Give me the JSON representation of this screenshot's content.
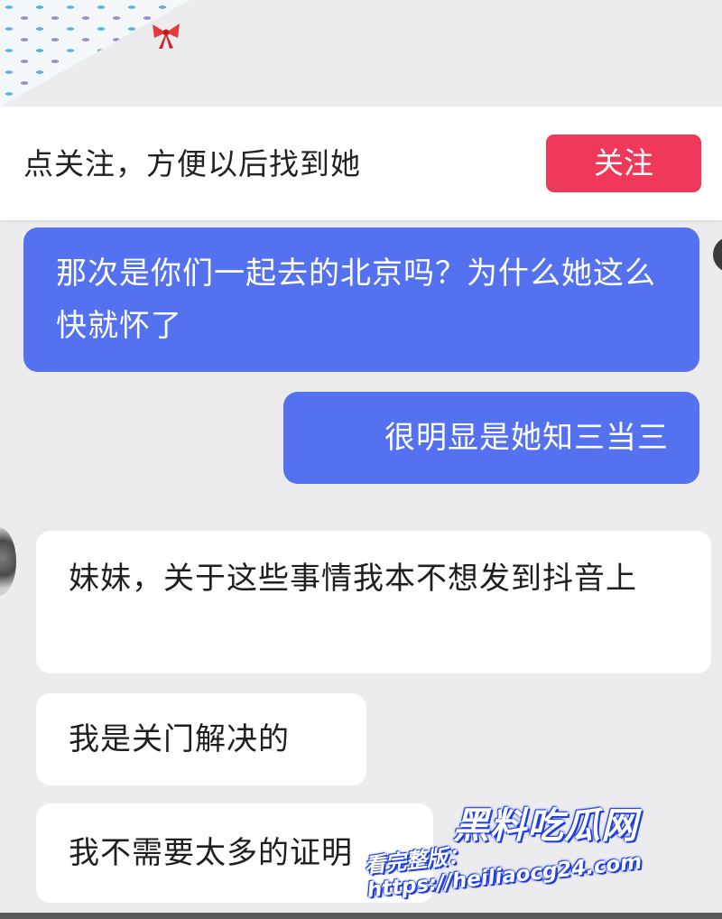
{
  "follow_bar": {
    "prompt": "点关注，方便以后找到她",
    "follow_label": "关注",
    "accent": "#f0395a"
  },
  "messages": [
    {
      "side": "sent",
      "text": "那次是你们一起去的北京吗？为什么她这么快就怀了"
    },
    {
      "side": "sent",
      "text": "很明显是她知三当三"
    },
    {
      "side": "received",
      "text": "妹妹，关于这些事情我本不想发到抖音上"
    },
    {
      "side": "received",
      "text": "我是关门解决的"
    },
    {
      "side": "received",
      "text": "我不需要太多的证明"
    }
  ],
  "colors": {
    "sent_bubble": "#5472ef",
    "received_bubble": "#ffffff",
    "background": "#ececee"
  },
  "watermark": {
    "title": "黑料吃瓜网",
    "url": "看完整版：https://heiliaocg24.com"
  }
}
